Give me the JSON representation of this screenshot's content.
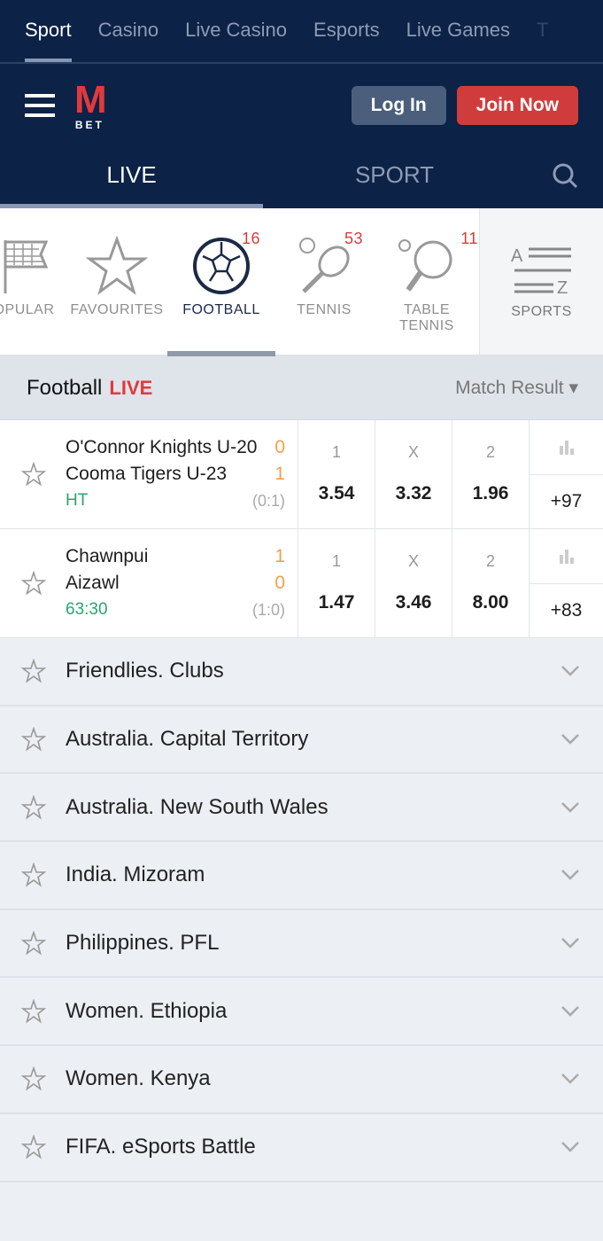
{
  "top_nav": [
    "Sport",
    "Casino",
    "Live Casino",
    "Esports",
    "Live Games",
    "T"
  ],
  "header": {
    "logo": "MBET",
    "logo_m": "M",
    "logo_bet": "BET",
    "login": "Log In",
    "join": "Join Now"
  },
  "tabs": [
    "LIVE",
    "SPORT"
  ],
  "sports": [
    {
      "label": "OPULAR",
      "icon": "flag-icon",
      "count": ""
    },
    {
      "label": "FAVOURITES",
      "icon": "star-icon",
      "count": ""
    },
    {
      "label": "FOOTBALL",
      "icon": "football-icon",
      "count": "16"
    },
    {
      "label": "TENNIS",
      "icon": "tennis-icon",
      "count": "53"
    },
    {
      "label": "TABLE TENNIS",
      "icon": "table-tennis-icon",
      "count": "11"
    }
  ],
  "az": {
    "a": "A",
    "z": "Z",
    "label": "SPORTS"
  },
  "section": {
    "title": "Football",
    "live": "LIVE",
    "market": "Match Result ▾"
  },
  "matches": [
    {
      "home": "O'Connor Knights U-20",
      "away": "Cooma Tigers U-23",
      "home_score": "0",
      "away_score": "1",
      "status": "HT",
      "ht": "(0:1)",
      "labels": [
        "1",
        "X",
        "2"
      ],
      "odds": [
        "3.54",
        "3.32",
        "1.96"
      ],
      "more": "+97"
    },
    {
      "home": "Chawnpui",
      "away": "Aizawl",
      "home_score": "1",
      "away_score": "0",
      "status": "63:30",
      "ht": "(1:0)",
      "labels": [
        "1",
        "X",
        "2"
      ],
      "odds": [
        "1.47",
        "3.46",
        "8.00"
      ],
      "more": "+83"
    }
  ],
  "leagues": [
    "Friendlies. Clubs",
    "Australia. Capital Territory",
    "Australia. New South Wales",
    "India. Mizoram",
    "Philippines. PFL",
    "Women. Ethiopia",
    "Women. Kenya",
    "FIFA. eSports Battle"
  ],
  "colors": {
    "navy": "#0c2246",
    "accent_red": "#d03c3c",
    "score": "#f0a04b",
    "live_green": "#2aa56d"
  }
}
